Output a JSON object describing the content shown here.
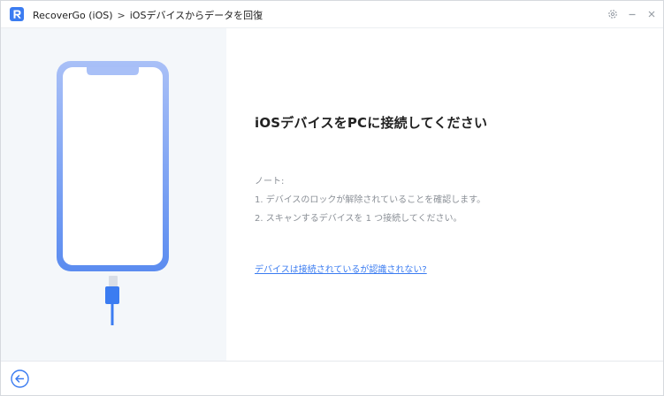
{
  "titlebar": {
    "app_name": "RecoverGo (iOS)",
    "separator": ">",
    "page": "iOSデバイスからデータを回復",
    "icons": [
      "app-logo-icon",
      "gear-icon",
      "minimize-icon",
      "close-icon"
    ]
  },
  "main": {
    "heading": "iOSデバイスをPCに接続してください",
    "notes": {
      "title": "ノート:",
      "items": [
        "1. デバイスのロックが解除されていることを確認します。",
        "2. スキャンするデバイスを 1 つ接続してください。"
      ]
    },
    "help_link": "デバイスは接続されているが認識されない?"
  },
  "footer": {
    "back_icon": "arrow-left-circle-icon"
  },
  "colors": {
    "accent": "#3b7cf1",
    "phone_gradient_top": "#a9c0f7",
    "phone_gradient_bottom": "#5b8cf0",
    "left_panel_bg": "#f4f7fa",
    "note_text": "#8a8f96"
  }
}
